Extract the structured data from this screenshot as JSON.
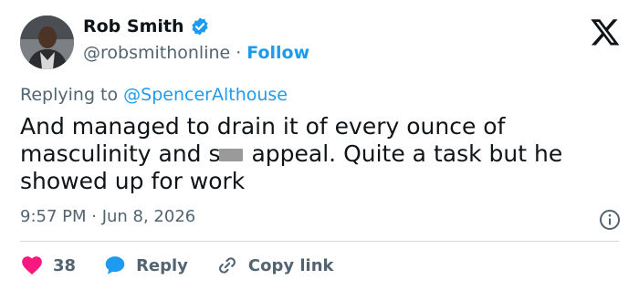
{
  "tweet": {
    "author": {
      "name": "Rob Smith",
      "handle": "@robsmithonline",
      "separator": "·",
      "follow_label": "Follow",
      "verified_color": "#1d9bf0"
    },
    "replying_prefix": "Replying to",
    "replying_to": "@SpencerAlthouse",
    "text_before_censor": "And managed to drain it of every ounce of masculinity and s",
    "text_after_censor": " appeal. Quite a task but he showed up for work",
    "timestamp": "9:57 PM · Jun 8, 2026",
    "actions": {
      "like_count": "38",
      "reply_label": "Reply",
      "copy_label": "Copy link"
    }
  },
  "icons": {
    "logo": "x-logo-icon",
    "info": "info-icon",
    "like": "heart-icon",
    "reply": "speech-bubble-icon",
    "copy": "link-icon"
  },
  "colors": {
    "like": "#f91880",
    "reply": "#1d9bf0",
    "accent": "#1d9bf0",
    "muted": "#536471"
  }
}
